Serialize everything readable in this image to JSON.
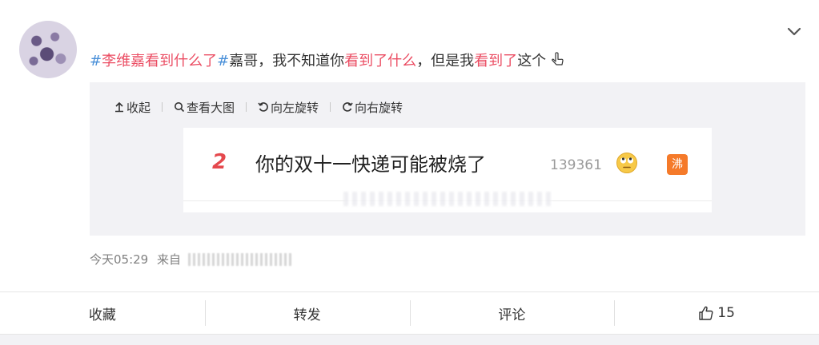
{
  "post": {
    "topic_segments": [
      {
        "text": "#",
        "style": "tag-blue"
      },
      {
        "text": "李维嘉看到什么了",
        "style": "hl"
      },
      {
        "text": "#",
        "style": "tag-blue"
      },
      {
        "text": "嘉哥，我不知道你",
        "style": "plain"
      },
      {
        "text": "看到了什么",
        "style": "hl"
      },
      {
        "text": "，但是我",
        "style": "plain"
      },
      {
        "text": "看到了",
        "style": "hl"
      },
      {
        "text": "这个",
        "style": "plain"
      }
    ],
    "pointer_icon": "pointing-hand-down-icon"
  },
  "media_toolbar": {
    "collapse_label": "收起",
    "view_large_label": "查看大图",
    "rotate_left_label": "向左旋转",
    "rotate_right_label": "向右旋转"
  },
  "hot_search_card": {
    "rank": "2",
    "headline": "你的双十一快递可能被烧了",
    "count": "139361",
    "emoji": "rolling-eyes-emoji",
    "badge": "沸"
  },
  "meta": {
    "time": "今天05:29",
    "source_prefix": "来自"
  },
  "actions": {
    "favorite_label": "收藏",
    "repost_label": "转发",
    "comment_label": "评论",
    "like_count": "15"
  },
  "colors": {
    "highlight": "#eb4d63",
    "tag": "#4a90d9",
    "badge": "#f57a2a"
  }
}
